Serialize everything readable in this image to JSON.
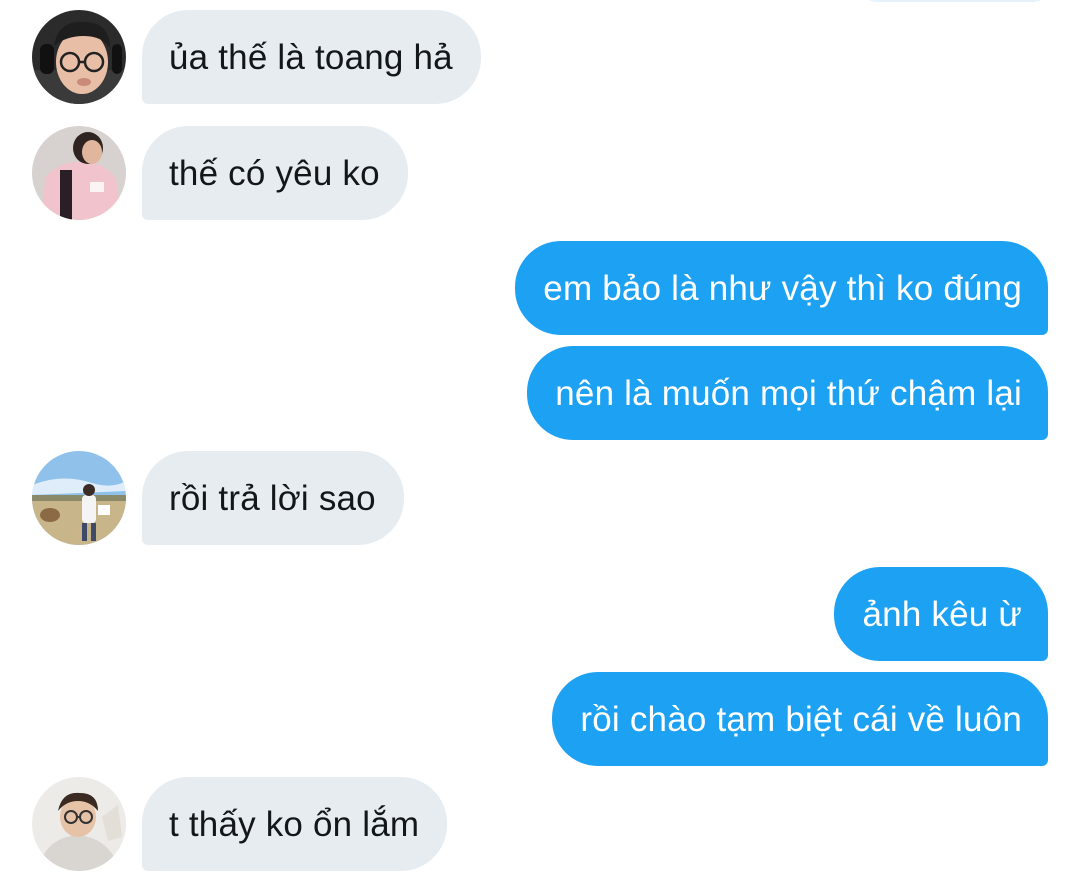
{
  "conversation": {
    "messages": [
      {
        "direction": "incoming",
        "text": "ủa thế là toang hả",
        "avatar_icon": "avatar-glasses-headset"
      },
      {
        "direction": "incoming",
        "text": "thế có yêu ko",
        "avatar_icon": "avatar-pink-jacket"
      },
      {
        "direction": "outgoing",
        "text": "em bảo là như vậy thì ko đúng"
      },
      {
        "direction": "outgoing",
        "text": "nên là muốn mọi thứ chậm lại"
      },
      {
        "direction": "incoming",
        "text": "rồi trả lời sao",
        "avatar_icon": "avatar-outdoor-field"
      },
      {
        "direction": "outgoing",
        "text": "ảnh kêu ừ"
      },
      {
        "direction": "outgoing",
        "text": "rồi chào tạm biệt cái về luôn"
      },
      {
        "direction": "incoming",
        "text": "t thấy ko ổn lắm",
        "avatar_icon": "avatar-glasses-hoodie"
      }
    ]
  },
  "colors": {
    "incoming_bubble": "#e6ecf0",
    "outgoing_bubble": "#1da1f2",
    "incoming_text": "#14171a",
    "outgoing_text": "#ffffff"
  }
}
